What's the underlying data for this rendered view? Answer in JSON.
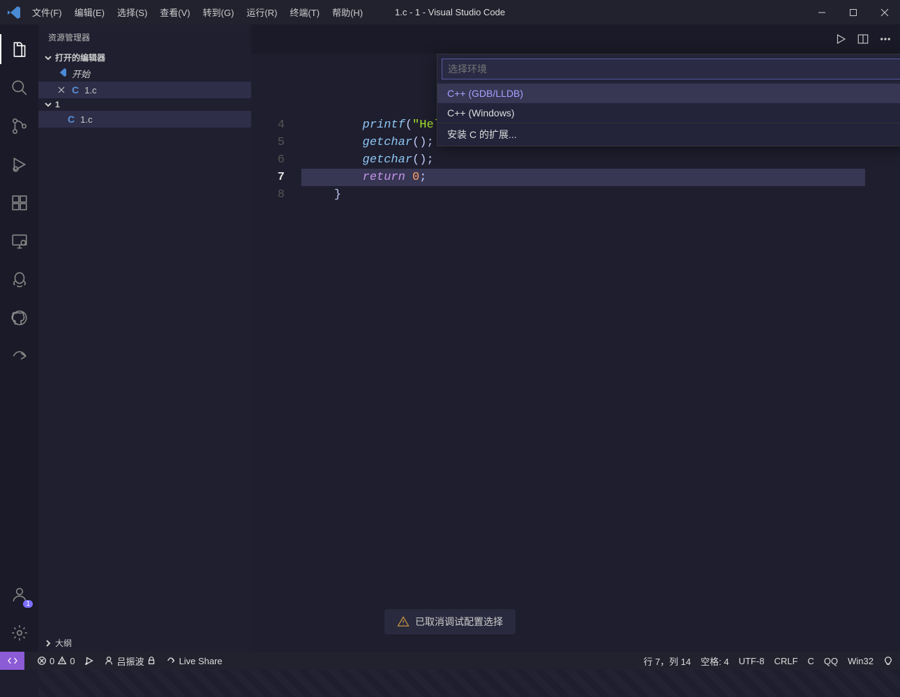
{
  "titlebar": {
    "app_title": "1.c - 1 - Visual Studio Code",
    "menus": [
      "文件(F)",
      "编辑(E)",
      "选择(S)",
      "查看(V)",
      "转到(G)",
      "运行(R)",
      "终端(T)",
      "帮助(H)"
    ]
  },
  "sidebar": {
    "header": "资源管理器",
    "open_editors_label": "打开的编辑器",
    "open_editors": [
      {
        "label": "开始",
        "kind": "welcome"
      },
      {
        "label": "1.c",
        "kind": "c",
        "modified": false
      }
    ],
    "folder_name": "1",
    "files": [
      {
        "label": "1.c",
        "kind": "c",
        "selected": true
      }
    ],
    "outline_label": "大纲"
  },
  "quickpick": {
    "placeholder": "选择环境",
    "options": [
      {
        "label": "C++ (GDB/LLDB)",
        "selected": true
      },
      {
        "label": "C++ (Windows)",
        "selected": false
      }
    ],
    "install_label": "安装 C 的扩展..."
  },
  "editor": {
    "visible_lines": [
      {
        "n": 4,
        "indent": "        ",
        "tokens": [
          [
            "fn",
            "printf"
          ],
          [
            "pn",
            "("
          ],
          [
            "str",
            "\"Hello CSDN\""
          ],
          [
            "pn",
            ");"
          ]
        ]
      },
      {
        "n": 5,
        "indent": "        ",
        "tokens": [
          [
            "fn",
            "getchar"
          ],
          [
            "pn",
            "();"
          ]
        ]
      },
      {
        "n": 6,
        "indent": "        ",
        "tokens": [
          [
            "fn",
            "getchar"
          ],
          [
            "pn",
            "();"
          ]
        ]
      },
      {
        "n": 7,
        "indent": "        ",
        "tokens": [
          [
            "kw",
            "return"
          ],
          [
            "pn",
            " "
          ],
          [
            "num",
            "0"
          ],
          [
            "pn",
            ";"
          ]
        ],
        "active": true
      },
      {
        "n": 8,
        "indent": "    ",
        "tokens": [
          [
            "pn",
            "}"
          ]
        ]
      }
    ]
  },
  "toast": {
    "message": "已取消调试配置选择"
  },
  "statusbar": {
    "errors": "0",
    "warnings": "0",
    "user": "吕振波",
    "live_share": "Live Share",
    "cursor": "行 7，列 14",
    "spaces": "空格: 4",
    "encoding": "UTF-8",
    "eol": "CRLF",
    "lang": "C",
    "qq": "QQ",
    "platform": "Win32"
  },
  "activity_badge": "1"
}
